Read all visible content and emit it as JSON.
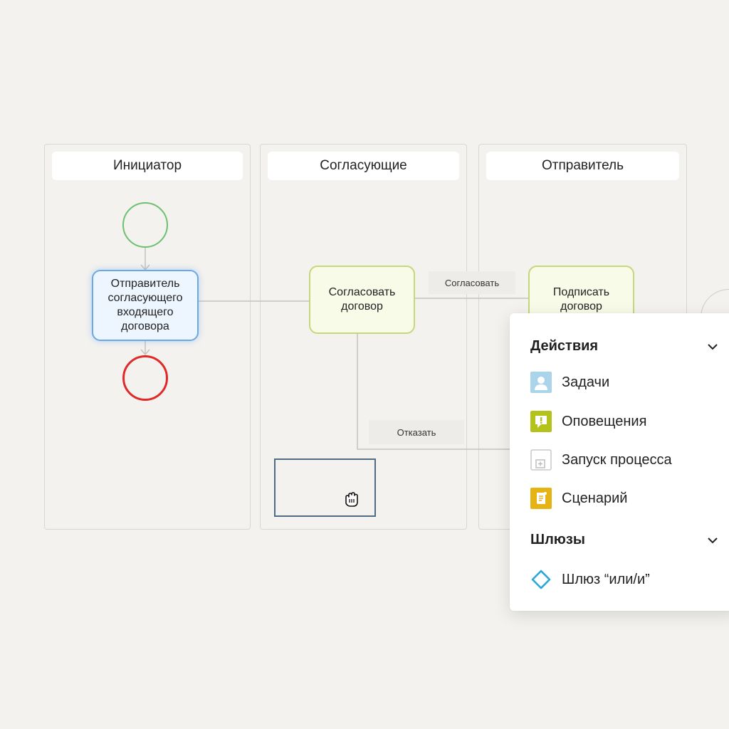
{
  "lanes": [
    {
      "title": "Инициатор"
    },
    {
      "title": "Согласующие"
    },
    {
      "title": "Отправитель"
    }
  ],
  "tasks": {
    "sender_task": "Отправитель согласующего входящего договора",
    "approve_task": "Согласовать договор",
    "sign_task": "Подписать договор"
  },
  "edges": {
    "approve": "Согласовать",
    "reject": "Отказать"
  },
  "panel": {
    "actions": {
      "title": "Действия",
      "items": [
        {
          "label": "Задачи",
          "icon": "user-task-icon",
          "color": "#a9d4ea"
        },
        {
          "label": "Оповещения",
          "icon": "notification-icon",
          "color": "#b4c21c"
        },
        {
          "label": "Запуск процесса",
          "icon": "process-launch-icon",
          "color": "#bdbdbd"
        },
        {
          "label": "Сценарий",
          "icon": "script-icon",
          "color": "#e6b315"
        }
      ]
    },
    "gateways": {
      "title": "Шлюзы",
      "items": [
        {
          "label": "Шлюз “или/и”",
          "icon": "gateway-diamond-icon",
          "color": "#27a8d8"
        }
      ]
    }
  },
  "colors": {
    "start_event": "#6cc06f",
    "end_event": "#e02a2a",
    "task_blue_border": "#6aa9e6",
    "task_green_border": "#c6d67a"
  }
}
